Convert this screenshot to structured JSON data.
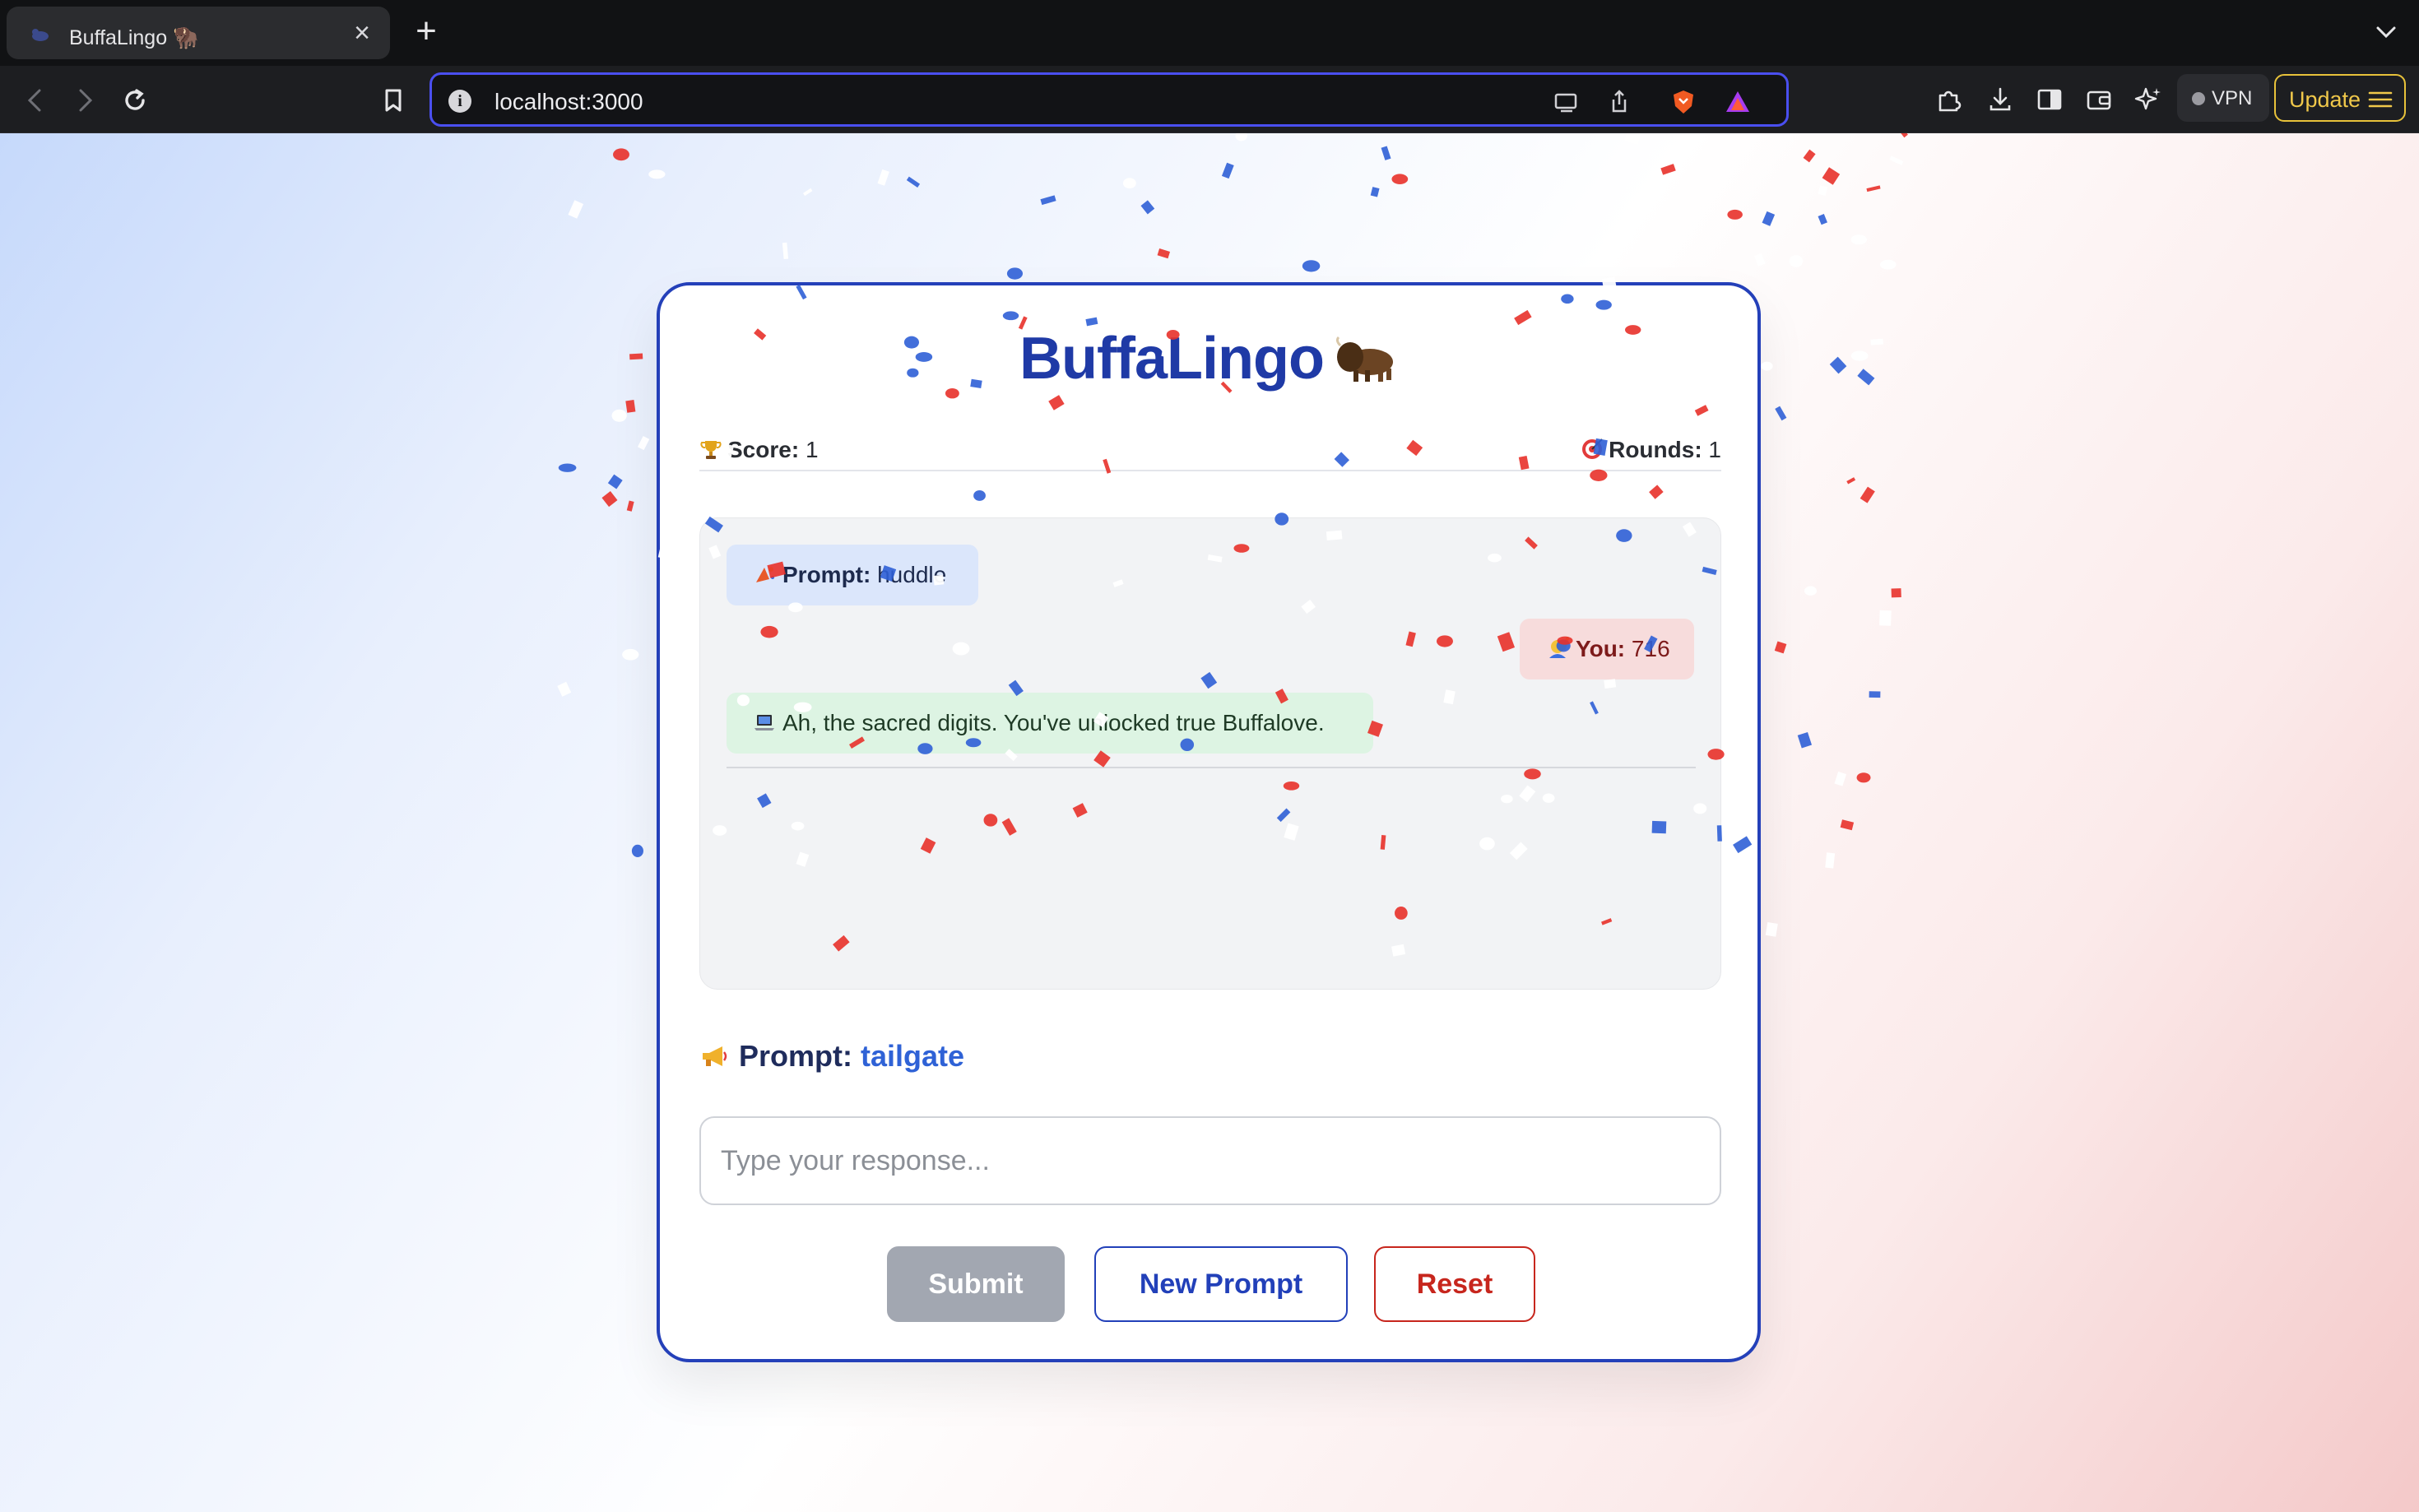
{
  "browser": {
    "tab_title": "BuffaLingo 🦬",
    "tab_close": "×",
    "new_tab": "+",
    "url": "localhost:3000",
    "vpn_label": "VPN",
    "update_label": "Update"
  },
  "app": {
    "title": "BuffaLingo",
    "title_icon": "bison-icon",
    "score_label": "Score:",
    "score_value": "1",
    "rounds_label": "Rounds:",
    "rounds_value": "1",
    "chat": {
      "prompt_label": "Prompt:",
      "prompt_value": "huddle",
      "user_label": "You:",
      "user_value": "716",
      "bot_message": "Ah, the sacred digits. You've unlocked true Buffalove."
    },
    "current_prompt_label": "Prompt:",
    "current_prompt_value": "tailgate",
    "input_placeholder": "Type your response...",
    "input_value": "",
    "buttons": {
      "submit": "Submit",
      "new_prompt": "New Prompt",
      "reset": "Reset"
    }
  },
  "colors": {
    "brand_blue": "#2240b9",
    "accent_red": "#c7261d",
    "confetti": [
      "#e8312a",
      "#2f5fd6",
      "#ffffff"
    ]
  }
}
